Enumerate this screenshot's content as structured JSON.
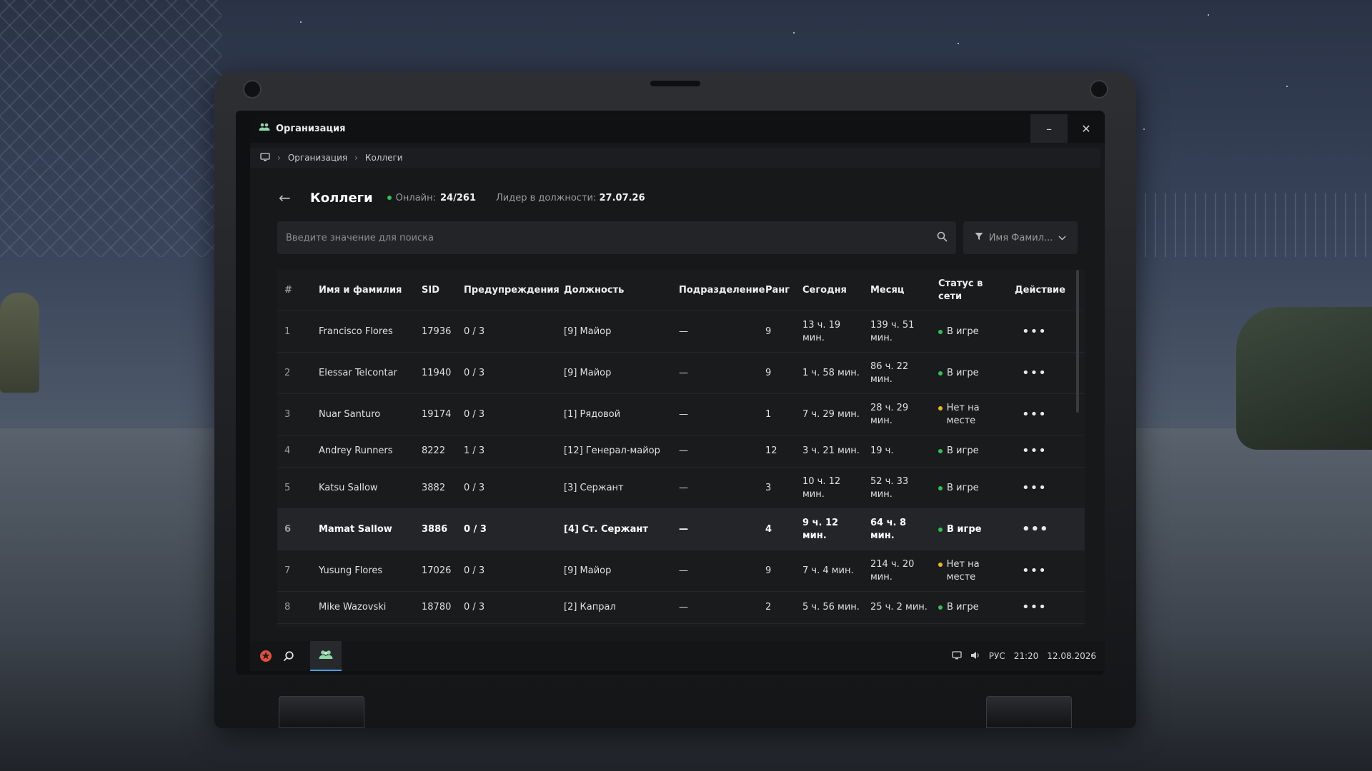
{
  "window": {
    "title": "Организация",
    "minimize_label": "–",
    "close_label": "✕"
  },
  "breadcrumb": {
    "items": [
      "Организация",
      "Коллеги"
    ],
    "separator": "›"
  },
  "header": {
    "back_label": "←",
    "title": "Коллеги",
    "online_label": "Онлайн:",
    "online_value": "24/261",
    "leader_label": "Лидер в должности:",
    "leader_value": "27.07.26"
  },
  "search": {
    "placeholder": "Введите значение для поиска",
    "filter_label": "Имя Фамил..."
  },
  "table": {
    "columns": [
      "#",
      "Имя и фамилия",
      "SID",
      "Предупреждения",
      "Должность",
      "Подразделение",
      "Ранг",
      "Сегодня",
      "Месяц",
      "Статус в сети",
      "Действие"
    ],
    "rows": [
      {
        "n": "1",
        "name": "Francisco Flores",
        "sid": "17936",
        "warn": "0 / 3",
        "post": "[9] Майор",
        "dept": "—",
        "rank": "9",
        "today": "13 ч. 19 мин.",
        "month": "139 ч. 51 мин.",
        "status": "В игре",
        "status_type": "online"
      },
      {
        "n": "2",
        "name": "Elessar Telcontar",
        "sid": "11940",
        "warn": "0 / 3",
        "post": "[9] Майор",
        "dept": "—",
        "rank": "9",
        "today": "1 ч. 58 мин.",
        "month": "86 ч. 22 мин.",
        "status": "В игре",
        "status_type": "online"
      },
      {
        "n": "3",
        "name": "Nuar Santuro",
        "sid": "19174",
        "warn": "0 / 3",
        "post": "[1] Рядовой",
        "dept": "—",
        "rank": "1",
        "today": "7 ч. 29 мин.",
        "month": "28 ч. 29 мин.",
        "status": "Нет на месте",
        "status_type": "away"
      },
      {
        "n": "4",
        "name": "Andrey Runners",
        "sid": "8222",
        "warn": "1 / 3",
        "post": "[12] Генерал-майор",
        "dept": "—",
        "rank": "12",
        "today": "3 ч. 21 мин.",
        "month": "19 ч.",
        "status": "В игре",
        "status_type": "online"
      },
      {
        "n": "5",
        "name": "Katsu Sallow",
        "sid": "3882",
        "warn": "0 / 3",
        "post": "[3] Сержант",
        "dept": "—",
        "rank": "3",
        "today": "10 ч. 12 мин.",
        "month": "52 ч. 33 мин.",
        "status": "В игре",
        "status_type": "online"
      },
      {
        "n": "6",
        "name": "Mamat Sallow",
        "sid": "3886",
        "warn": "0 / 3",
        "post": "[4] Ст. Сержант",
        "dept": "—",
        "rank": "4",
        "today": "9 ч. 12 мин.",
        "month": "64 ч. 8 мин.",
        "status": "В игре",
        "status_type": "online"
      },
      {
        "n": "7",
        "name": "Yusung Flores",
        "sid": "17026",
        "warn": "0 / 3",
        "post": "[9] Майор",
        "dept": "—",
        "rank": "9",
        "today": "7 ч. 4 мин.",
        "month": "214 ч. 20 мин.",
        "status": "Нет на месте",
        "status_type": "away"
      },
      {
        "n": "8",
        "name": "Mike Wazovski",
        "sid": "18780",
        "warn": "0 / 3",
        "post": "[2] Капрал",
        "dept": "—",
        "rank": "2",
        "today": "5 ч. 56 мин.",
        "month": "25 ч. 2 мин.",
        "status": "В игре",
        "status_type": "online"
      }
    ],
    "action_label": "•••"
  },
  "taskbar": {
    "lang": "РУС",
    "time": "21:20",
    "date": "12.08.2026",
    "accent_color": "#3ea0ff",
    "online_color": "#30c253",
    "away_color": "#e6b81d"
  }
}
